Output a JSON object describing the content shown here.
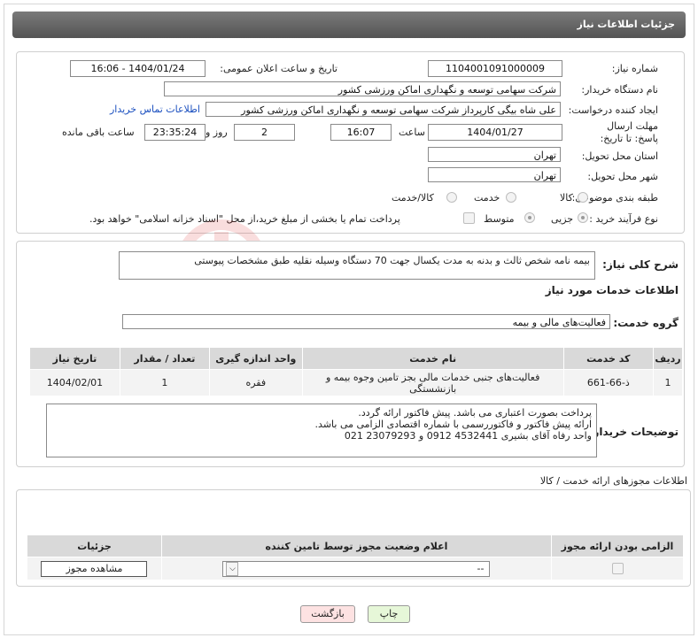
{
  "header": {
    "title": "جزئیات اطلاعات نیاز"
  },
  "form": {
    "need_number_label": "شماره نیاز:",
    "need_number": "1104001091000009",
    "announce_label": "تاریخ و ساعت اعلان عمومی:",
    "announce_value": "1404/01/24 - 16:06",
    "buyer_label": "نام دستگاه خریدار:",
    "buyer_value": "شرکت سهامی توسعه و نگهداری اماکن ورزشی کشور",
    "creator_label": "ایجاد کننده درخواست:",
    "creator_value": "علی شاه بیگی کارپرداز شرکت سهامی توسعه و نگهداری اماکن ورزشی کشور",
    "contact_link": "اطلاعات تماس خریدار",
    "deadline_label": "مهلت ارسال پاسخ: تا تاریخ:",
    "deadline_date": "1404/01/27",
    "time_label": "ساعت",
    "deadline_time": "16:07",
    "days_value": "2",
    "days_label": "روز و",
    "remaining_value": "23:35:24",
    "remaining_label": "ساعت باقی مانده",
    "province_label": "استان محل تحویل:",
    "province_value": "تهران",
    "city_label": "شهر محل تحویل:",
    "city_value": "تهران",
    "category_label": "طبقه بندی موضوعی:",
    "category_options": [
      "کالا",
      "خدمت",
      "کالا/خدمت"
    ],
    "process_label": "نوع فرآیند خرید :",
    "process_options": [
      "جزیی",
      "متوسط"
    ],
    "treasury_text": "پرداخت تمام یا بخشی از مبلغ خرید،از محل \"اسناد خزانه اسلامی\" خواهد بود."
  },
  "summary": {
    "label": "شرح کلی نیاز:",
    "value": "بیمه نامه شخص ثالث و بدنه به مدت یکسال جهت 70 دستگاه وسیله نقلیه طبق مشخصات پیوستی"
  },
  "services": {
    "title": "اطلاعات خدمات مورد نیاز",
    "group_label": "گروه خدمت:",
    "group_value": "فعالیت‌های مالی و بیمه",
    "columns": [
      "ردیف",
      "کد خدمت",
      "نام خدمت",
      "واحد اندازه گیری",
      "تعداد / مقدار",
      "تاریخ نیاز"
    ],
    "rows": [
      {
        "row": "1",
        "code": "ذ-66-661",
        "name": "فعالیت‌های جنبی خدمات مالی بجز تامین وجوه بیمه و بازنشستگی",
        "unit": "فقره",
        "qty": "1",
        "date": "1404/02/01"
      }
    ]
  },
  "buyer_notes": {
    "label": "توضیحات خریدار:",
    "lines": [
      "پرداخت بصورت اعتباری می باشد. پیش فاکتور ارائه گردد.",
      "ارائه پیش فاکتور و فاکتوررسمی با شماره اقتصادی الزامی می باشد.",
      "واحد رفاه آقای بشیری 4532441  0912   و   23079293 021"
    ]
  },
  "permits": {
    "title": "اطلاعات مجوزهای ارائه خدمت / کالا",
    "columns": [
      "الزامی بودن ارائه مجوز",
      "اعلام وضعیت مجوز توسط تامین کننده",
      "جزئیات"
    ],
    "select_value": "--",
    "view_button": "مشاهده مجوز"
  },
  "actions": {
    "print": "چاپ",
    "back": "بازگشت"
  },
  "colors": {
    "header_bg": "#646464",
    "link": "#1a4fbf",
    "print_btn": "#e6f7d8",
    "back_btn": "#fde2e2"
  }
}
